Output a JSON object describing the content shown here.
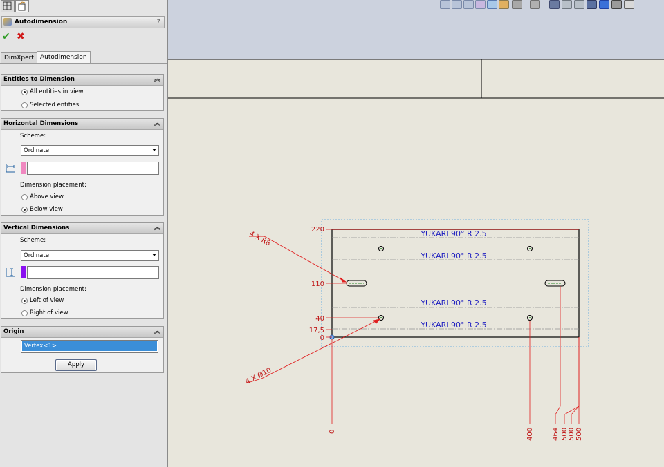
{
  "property_manager": {
    "title": "Autodimension",
    "help": "?",
    "ok_symbol": "✔",
    "cancel_symbol": "✖",
    "tabs": [
      "DimXpert",
      "Autodimension"
    ],
    "entities": {
      "header": "Entities to Dimension",
      "options": [
        "All entities in view",
        "Selected entities"
      ],
      "selected": 0
    },
    "horizontal": {
      "header": "Horizontal Dimensions",
      "scheme_label": "Scheme:",
      "scheme_value": "Ordinate",
      "placement_label": "Dimension placement:",
      "options": [
        "Above view",
        "Below view"
      ],
      "selected": 1,
      "swatch_color": "#f088c0"
    },
    "vertical": {
      "header": "Vertical Dimensions",
      "scheme_label": "Scheme:",
      "scheme_value": "Ordinate",
      "placement_label": "Dimension placement:",
      "options": [
        "Left of view",
        "Right of view"
      ],
      "selected": 0,
      "swatch_color": "#8a10f0"
    },
    "origin": {
      "header": "Origin",
      "value": "Vertex<1>",
      "apply_label": "Apply"
    }
  },
  "drawing": {
    "notes": [
      "YUKARI  90°  R 2.5",
      "YUKARI  90°  R 2.5",
      "YUKARI  90°  R 2.5",
      "YUKARI  90°  R 2.5"
    ],
    "callouts": [
      "4 X R8",
      "4 X Ø10"
    ],
    "vertical_ordinates": [
      "220",
      "110",
      "40",
      "17,5",
      "0"
    ],
    "horizontal_ordinates": [
      "0",
      "400",
      "464",
      "500",
      "500",
      "500"
    ],
    "colors": {
      "dimension": "#e02020",
      "note": "#2020c0",
      "selection_box": "#4ea0e0"
    }
  }
}
